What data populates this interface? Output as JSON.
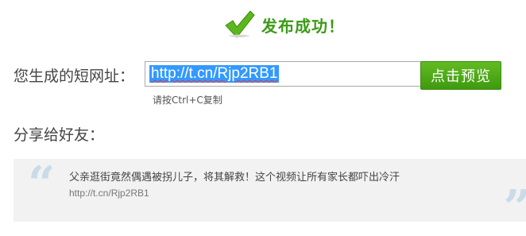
{
  "status": {
    "icon": "check-icon",
    "message": "发布成功！",
    "color": "#3c9a17"
  },
  "short_url": {
    "label": "您生成的短网址：",
    "value": "http://t.cn/Rjp2RB1",
    "copy_hint": "请按Ctrl+C复制"
  },
  "preview_button": {
    "label": "点击预览",
    "color": "#4aa818"
  },
  "share": {
    "label": "分享给好友：",
    "title": "父亲逛街竟然偶遇被拐儿子，将其解救！这个视频让所有家长都吓出冷汗",
    "link": "http://t.cn/Rjp2RB1",
    "icons": [
      "quote-open-icon",
      "quote-close-icon"
    ]
  }
}
